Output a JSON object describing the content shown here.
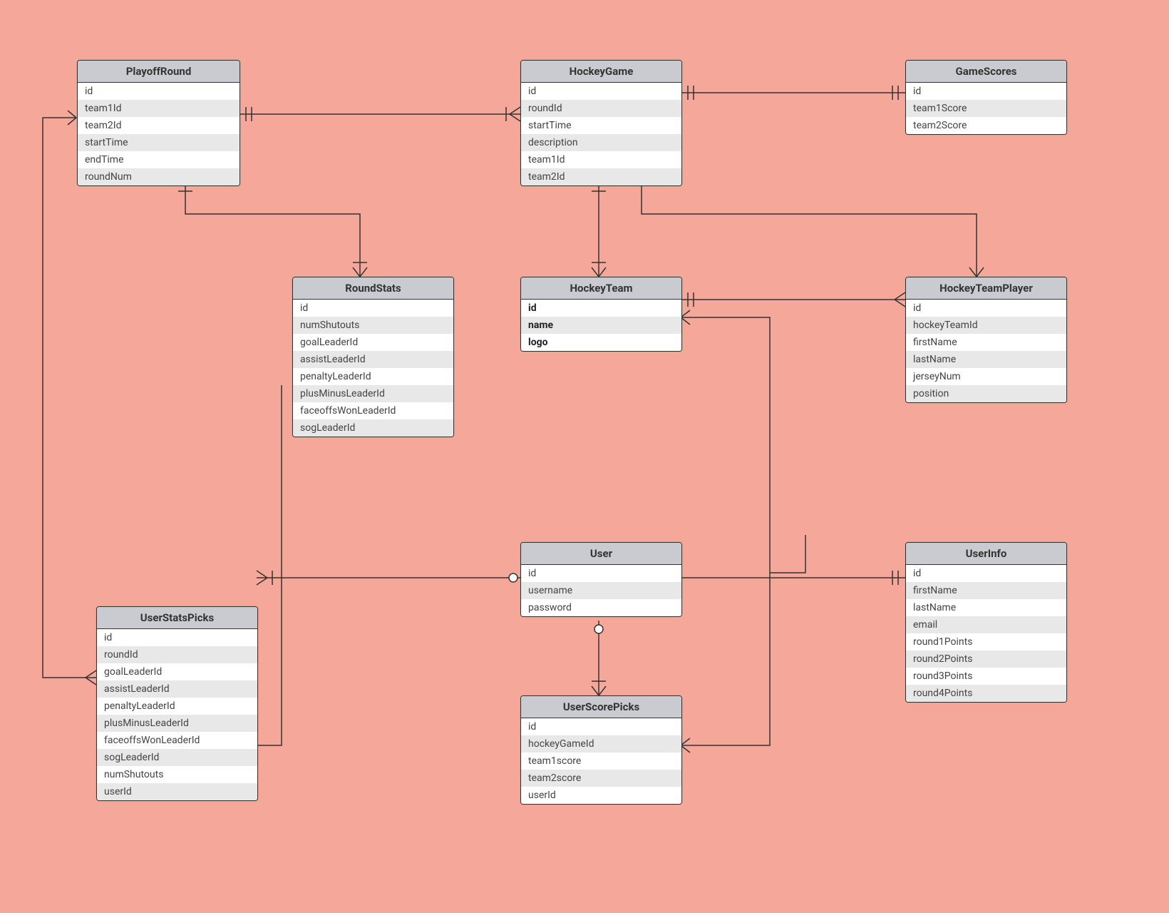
{
  "entities": {
    "playoffRound": {
      "name": "PlayoffRound",
      "fields": [
        "id",
        "team1Id",
        "team2Id",
        "startTime",
        "endTime",
        "roundNum"
      ]
    },
    "hockeyGame": {
      "name": "HockeyGame",
      "fields": [
        "id",
        "roundId",
        "startTime",
        "description",
        "team1Id",
        "team2Id"
      ]
    },
    "gameScores": {
      "name": "GameScores",
      "fields": [
        "id",
        "team1Score",
        "team2Score"
      ]
    },
    "roundStats": {
      "name": "RoundStats",
      "fields": [
        "id",
        "numShutouts",
        "goalLeaderId",
        "assistLeaderId",
        "penaltyLeaderId",
        "plusMinusLeaderId",
        "faceoffsWonLeaderId",
        "sogLeaderId"
      ]
    },
    "hockeyTeam": {
      "name": "HockeyTeam",
      "fields": [
        "id",
        "name",
        "logo"
      ],
      "boldFields": true
    },
    "hockeyTeamPlayer": {
      "name": "HockeyTeamPlayer",
      "fields": [
        "id",
        "hockeyTeamId",
        "firstName",
        "lastName",
        "jerseyNum",
        "position"
      ]
    },
    "user": {
      "name": "User",
      "fields": [
        "id",
        "username",
        "password"
      ]
    },
    "userInfo": {
      "name": "UserInfo",
      "fields": [
        "id",
        "firstName",
        "lastName",
        "email",
        "round1Points",
        "round2Points",
        "round3Points",
        "round4Points"
      ]
    },
    "userStatsPicks": {
      "name": "UserStatsPicks",
      "fields": [
        "id",
        "roundId",
        "goalLeaderId",
        "assistLeaderId",
        "penaltyLeaderId",
        "plusMinusLeaderId",
        "faceoffsWonLeaderId",
        "sogLeaderId",
        "numShutouts",
        "userId"
      ]
    },
    "userScorePicks": {
      "name": "UserScorePicks",
      "fields": [
        "id",
        "hockeyGameId",
        "team1score",
        "team2score",
        "userId"
      ]
    }
  }
}
